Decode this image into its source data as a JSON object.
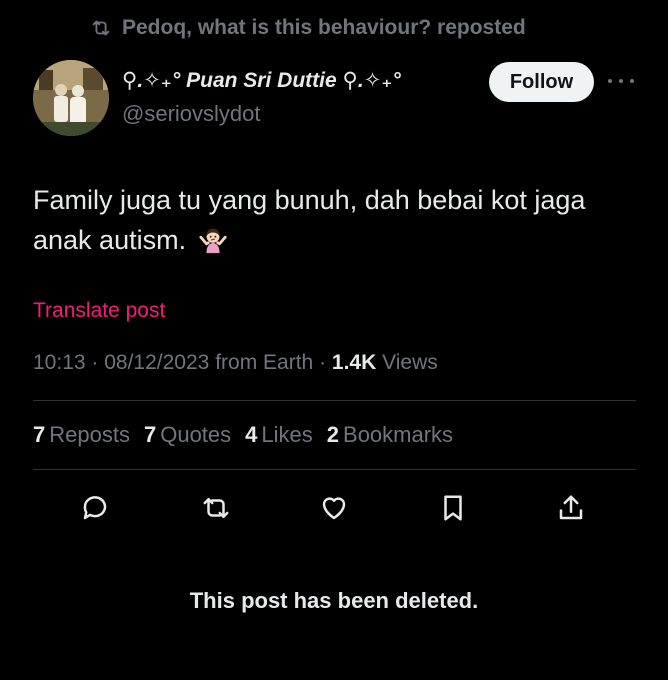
{
  "repost": {
    "text": "Pedoq, what is this behaviour? reposted"
  },
  "author": {
    "display_name": "⚲.✧₊° Puan Sri Duttie ⚲.✧₊°",
    "handle": "@seriovslydot"
  },
  "follow_label": "Follow",
  "post": {
    "text": "Family juga tu yang bunuh, dah bebai kot jaga anak autism."
  },
  "translate_label": "Translate post",
  "meta": {
    "time": "10:13",
    "date": "08/12/2023",
    "source": "from Earth",
    "views_count": "1.4K",
    "views_label": "Views"
  },
  "stats": [
    {
      "count": "7",
      "label": "Reposts"
    },
    {
      "count": "7",
      "label": "Quotes"
    },
    {
      "count": "4",
      "label": "Likes"
    },
    {
      "count": "2",
      "label": "Bookmarks"
    }
  ],
  "actions": [
    "reply-icon",
    "repost-icon",
    "like-icon",
    "bookmark-icon",
    "share-icon"
  ],
  "deleted_notice": "This post has been deleted.",
  "colors": {
    "background": "#000000",
    "text": "#e7e9ea",
    "muted": "#71767b",
    "translate": "#f91880",
    "divider": "#2f3336",
    "follow_bg": "#eff3f4"
  }
}
